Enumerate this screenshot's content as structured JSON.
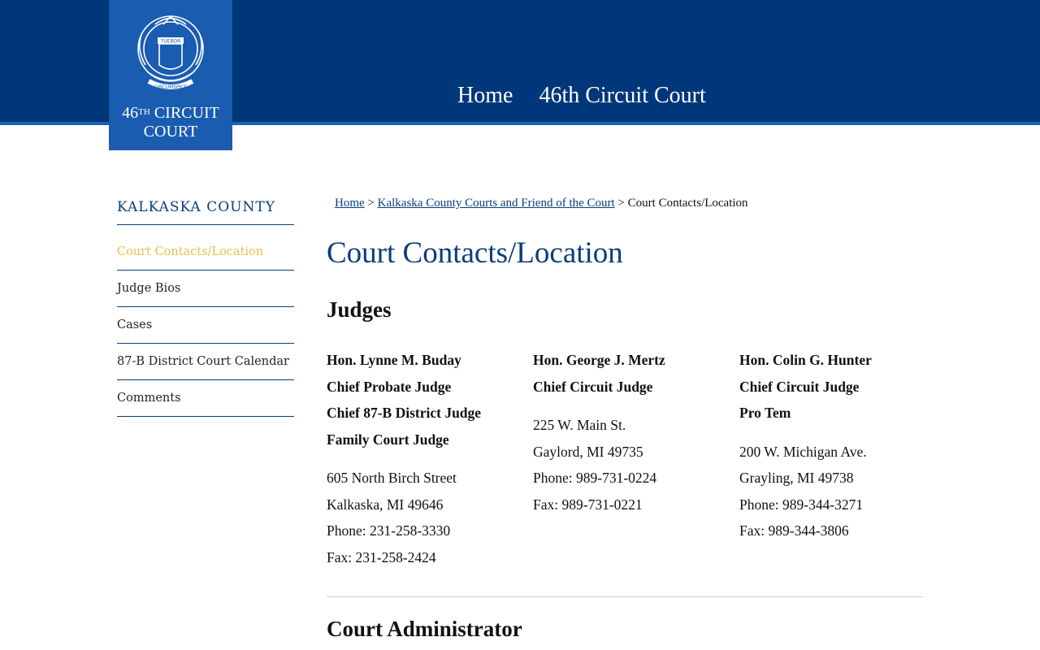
{
  "header": {
    "logo_line1": "46",
    "logo_sup": "TH",
    "logo_line1_rest": " CIRCUIT",
    "logo_line2": "COURT",
    "seal_motto": "TUEBOR",
    "seal_lower": "CIRCUMSPICE",
    "nav": [
      "Home",
      "46th Circuit Court"
    ]
  },
  "sidebar": {
    "title": "KALKASKA COUNTY",
    "items": [
      {
        "label": "Court Contacts/Location",
        "active": true
      },
      {
        "label": "Judge Bios"
      },
      {
        "label": "Cases"
      },
      {
        "label": "87-B District Court Calendar"
      },
      {
        "label": "Comments"
      }
    ]
  },
  "breadcrumb": {
    "home": "Home",
    "sep": " > ",
    "parent": "Kalkaska County Courts and Friend of the Court",
    "current": "Court Contacts/Location"
  },
  "main": {
    "title": "Court Contacts/Location",
    "judges_heading": "Judges",
    "admin_heading": "Court Administrator",
    "judges": [
      {
        "titles": [
          "Hon. Lynne M. Buday",
          "Chief Probate Judge",
          "Chief 87-B District Judge",
          "Family Court Judge"
        ],
        "address": [
          "605 North Birch Street",
          "Kalkaska, MI 49646"
        ],
        "phone": "Phone:  231-258-3330",
        "fax": "Fax:  231-258-2424"
      },
      {
        "titles": [
          "Hon. George J. Mertz",
          "Chief Circuit Judge"
        ],
        "address": [
          "225 W. Main St.",
          "Gaylord, MI 49735"
        ],
        "phone": "Phone:  989-731-0224",
        "fax": "Fax:  989-731-0221"
      },
      {
        "titles": [
          "Hon. Colin G. Hunter",
          "Chief Circuit Judge",
          "Pro Tem"
        ],
        "address": [
          "200 W. Michigan Ave.",
          "Grayling, MI 49738"
        ],
        "phone": "Phone:  989-344-3271",
        "fax": "Fax:  989-344-3806"
      }
    ]
  },
  "colors": {
    "header": "#00377a",
    "logo_bg": "#1a5cb0",
    "link": "#0b3d7a",
    "active_nav": "#e8c04a"
  }
}
